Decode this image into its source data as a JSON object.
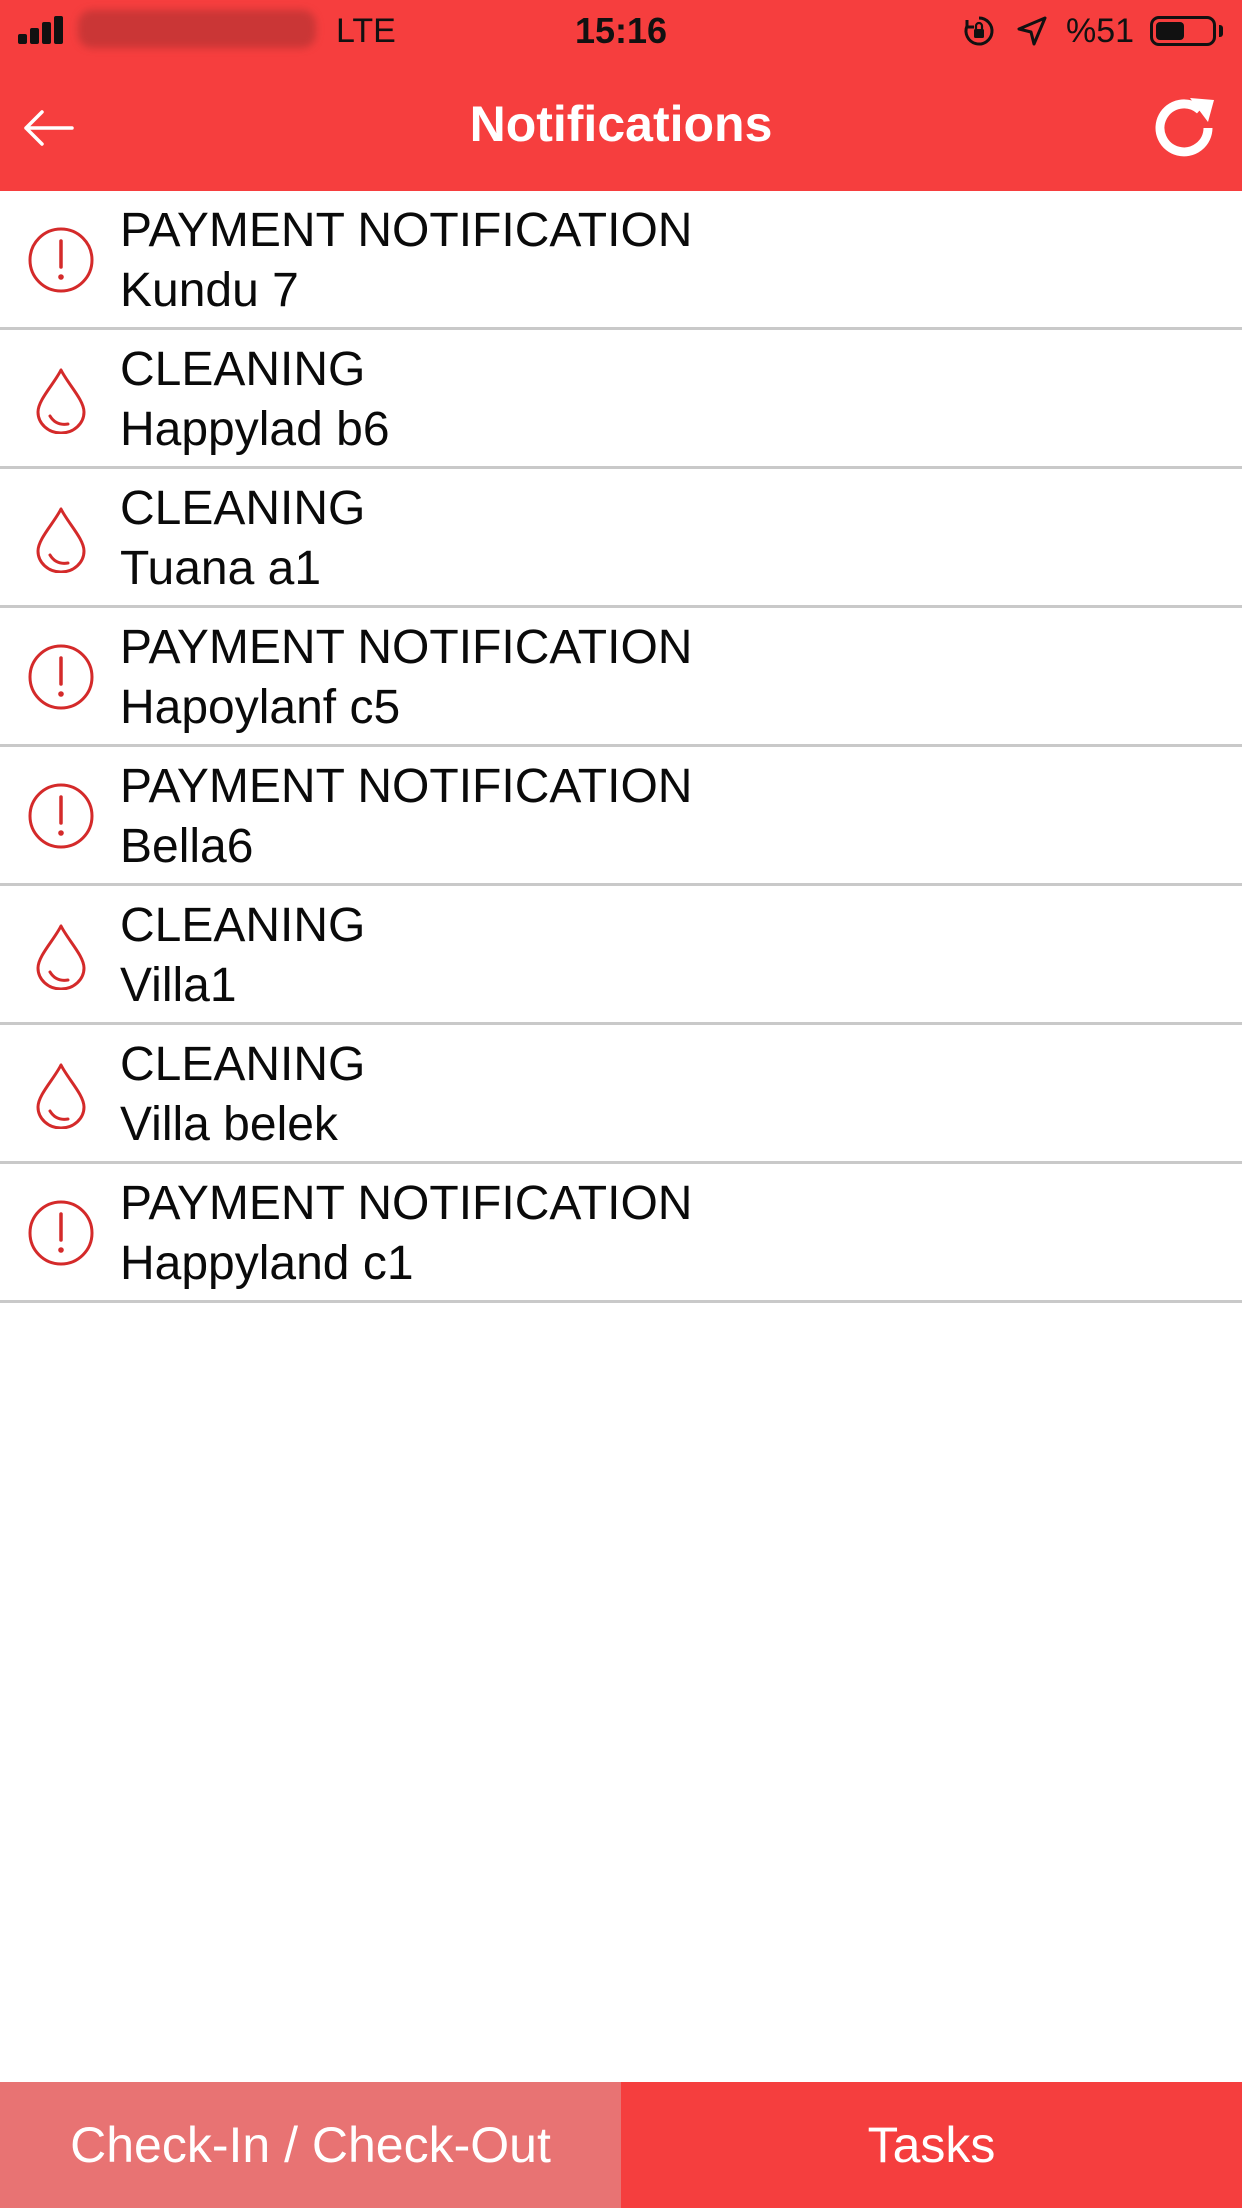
{
  "status_bar": {
    "network": "LTE",
    "time": "15:16",
    "battery_percent": "%51",
    "battery_level": 0.51,
    "icons": [
      "signal-icon",
      "orientation-lock-icon",
      "location-arrow-icon",
      "battery-icon"
    ]
  },
  "header": {
    "title": "Notifications",
    "back_icon": "arrow-left-icon",
    "refresh_icon": "refresh-icon",
    "background_color": "#f63e3e"
  },
  "notifications": [
    {
      "type": "PAYMENT NOTIFICATION",
      "name": "Kundu 7",
      "icon": "exclamation-circle-icon"
    },
    {
      "type": "CLEANING",
      "name": "Happylad b6",
      "icon": "water-drop-icon"
    },
    {
      "type": "CLEANING",
      "name": "Tuana a1",
      "icon": "water-drop-icon"
    },
    {
      "type": "PAYMENT NOTIFICATION",
      "name": "Hapoylanf c5",
      "icon": "exclamation-circle-icon"
    },
    {
      "type": "PAYMENT NOTIFICATION",
      "name": "Bella6",
      "icon": "exclamation-circle-icon"
    },
    {
      "type": "CLEANING",
      "name": "Villa1",
      "icon": "water-drop-icon"
    },
    {
      "type": "CLEANING",
      "name": "Villa belek",
      "icon": "water-drop-icon"
    },
    {
      "type": "PAYMENT NOTIFICATION",
      "name": "Happyland c1",
      "icon": "exclamation-circle-icon"
    }
  ],
  "tabs": {
    "checkin_label": "Check-In / Check-Out",
    "tasks_label": "Tasks"
  },
  "colors": {
    "accent": "#f63e3e",
    "icon_red": "#d42a2a",
    "tab_inactive": "#e87373",
    "tab_active": "#f53e3e"
  }
}
